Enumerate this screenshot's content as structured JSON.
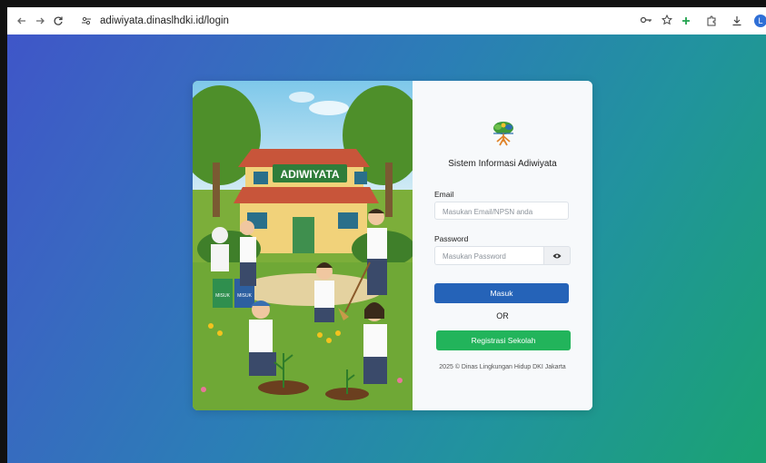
{
  "browser": {
    "url": "adiwiyata.dinaslhdki.id/login",
    "profile_initial": "L",
    "icons": {
      "back": "arrow-left-icon",
      "forward": "arrow-right-icon",
      "reload": "reload-icon",
      "site_info": "tune-icon",
      "password_key": "key-icon",
      "bookmark": "star-icon",
      "extension1": "plus-extension-icon",
      "extension2": "puzzle-icon",
      "download": "download-icon",
      "menu": "kebab-menu-icon"
    }
  },
  "illustration": {
    "sign_text": "ADIWIYATA",
    "bin_labels": [
      "MISUK",
      "MISUK"
    ]
  },
  "login": {
    "app_title": "Sistem Informasi Adiwiyata",
    "email_label": "Email",
    "email_placeholder": "Masukan Email/NPSN anda",
    "password_label": "Password",
    "password_placeholder": "Masukan Password",
    "submit_label": "Masuk",
    "or_text": "OR",
    "register_label": "Registrasi Sekolah",
    "footer": "2025 © Dinas Lingkungan Hidup DKI Jakarta"
  },
  "colors": {
    "primary_button": "#2563b8",
    "register_button": "#22b45b",
    "background_start": "#3f56c8",
    "background_end": "#1aa372"
  }
}
